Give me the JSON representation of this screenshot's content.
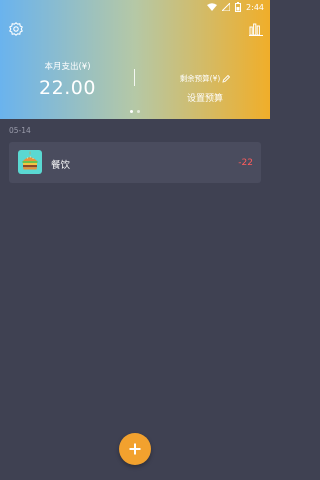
{
  "status_bar": {
    "time": "2:44",
    "icons": [
      "wifi-icon",
      "signal-icon",
      "battery-icon"
    ]
  },
  "header": {
    "settings_icon": "gear-icon",
    "stats_icon": "bar-chart-icon",
    "spend_label": "本月支出(¥)",
    "spend_amount": "22.00",
    "budget_label": "剩余预算(¥)",
    "budget_edit_icon": "pencil-icon",
    "budget_action": "设置预算",
    "page_indicator_count": 2,
    "page_indicator_active": 0
  },
  "records": {
    "date": "05-14",
    "items": [
      {
        "icon": "burger-icon",
        "category": "餐饮",
        "amount": "-22"
      }
    ]
  },
  "fab": {
    "icon": "plus-icon"
  },
  "colors": {
    "gradient_left": "#6ab3ee",
    "gradient_right": "#f0ae2a",
    "background": "#3f4152",
    "card": "#4a4c5e",
    "amount_red": "#ff5c5c",
    "fab": "#f2a12e"
  }
}
